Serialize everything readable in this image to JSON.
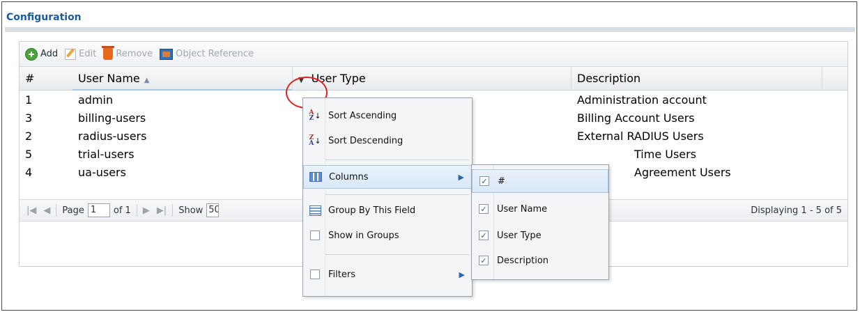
{
  "section": {
    "title": "Configuration"
  },
  "toolbar": {
    "add_label": "Add",
    "edit_label": "Edit",
    "remove_label": "Remove",
    "object_reference_label": "Object Reference"
  },
  "table": {
    "columns": [
      {
        "label": "#"
      },
      {
        "label": "User Name"
      },
      {
        "label": "User Type"
      },
      {
        "label": "Description"
      }
    ],
    "rows": [
      {
        "num": "1",
        "name": "admin",
        "description": "Administration account"
      },
      {
        "num": "3",
        "name": "billing-users",
        "description": "Billing Account Users"
      },
      {
        "num": "2",
        "name": "radius-users",
        "description": "External RADIUS Users"
      },
      {
        "num": "5",
        "name": "trial-users",
        "description": "Time Users"
      },
      {
        "num": "4",
        "name": "ua-users",
        "description": "Agreement Users"
      }
    ]
  },
  "pager": {
    "page_label": "Page",
    "page_value": "1",
    "of_label": "of 1",
    "show_label": "Show",
    "show_value": "50",
    "display_text": "Displaying 1 - 5 of 5"
  },
  "column_menu": {
    "sort_ascending": "Sort Ascending",
    "sort_descending": "Sort Descending",
    "columns": "Columns",
    "group_by": "Group By This Field",
    "show_in_groups": "Show in Groups",
    "filters": "Filters"
  },
  "columns_submenu": {
    "items": [
      {
        "label": "#",
        "checked": true
      },
      {
        "label": "User Name",
        "checked": true
      },
      {
        "label": "User Type",
        "checked": true
      },
      {
        "label": "Description",
        "checked": true
      }
    ]
  },
  "colors": {
    "title_blue": "#1c5aa0",
    "highlight_circle": "#e0231e"
  }
}
